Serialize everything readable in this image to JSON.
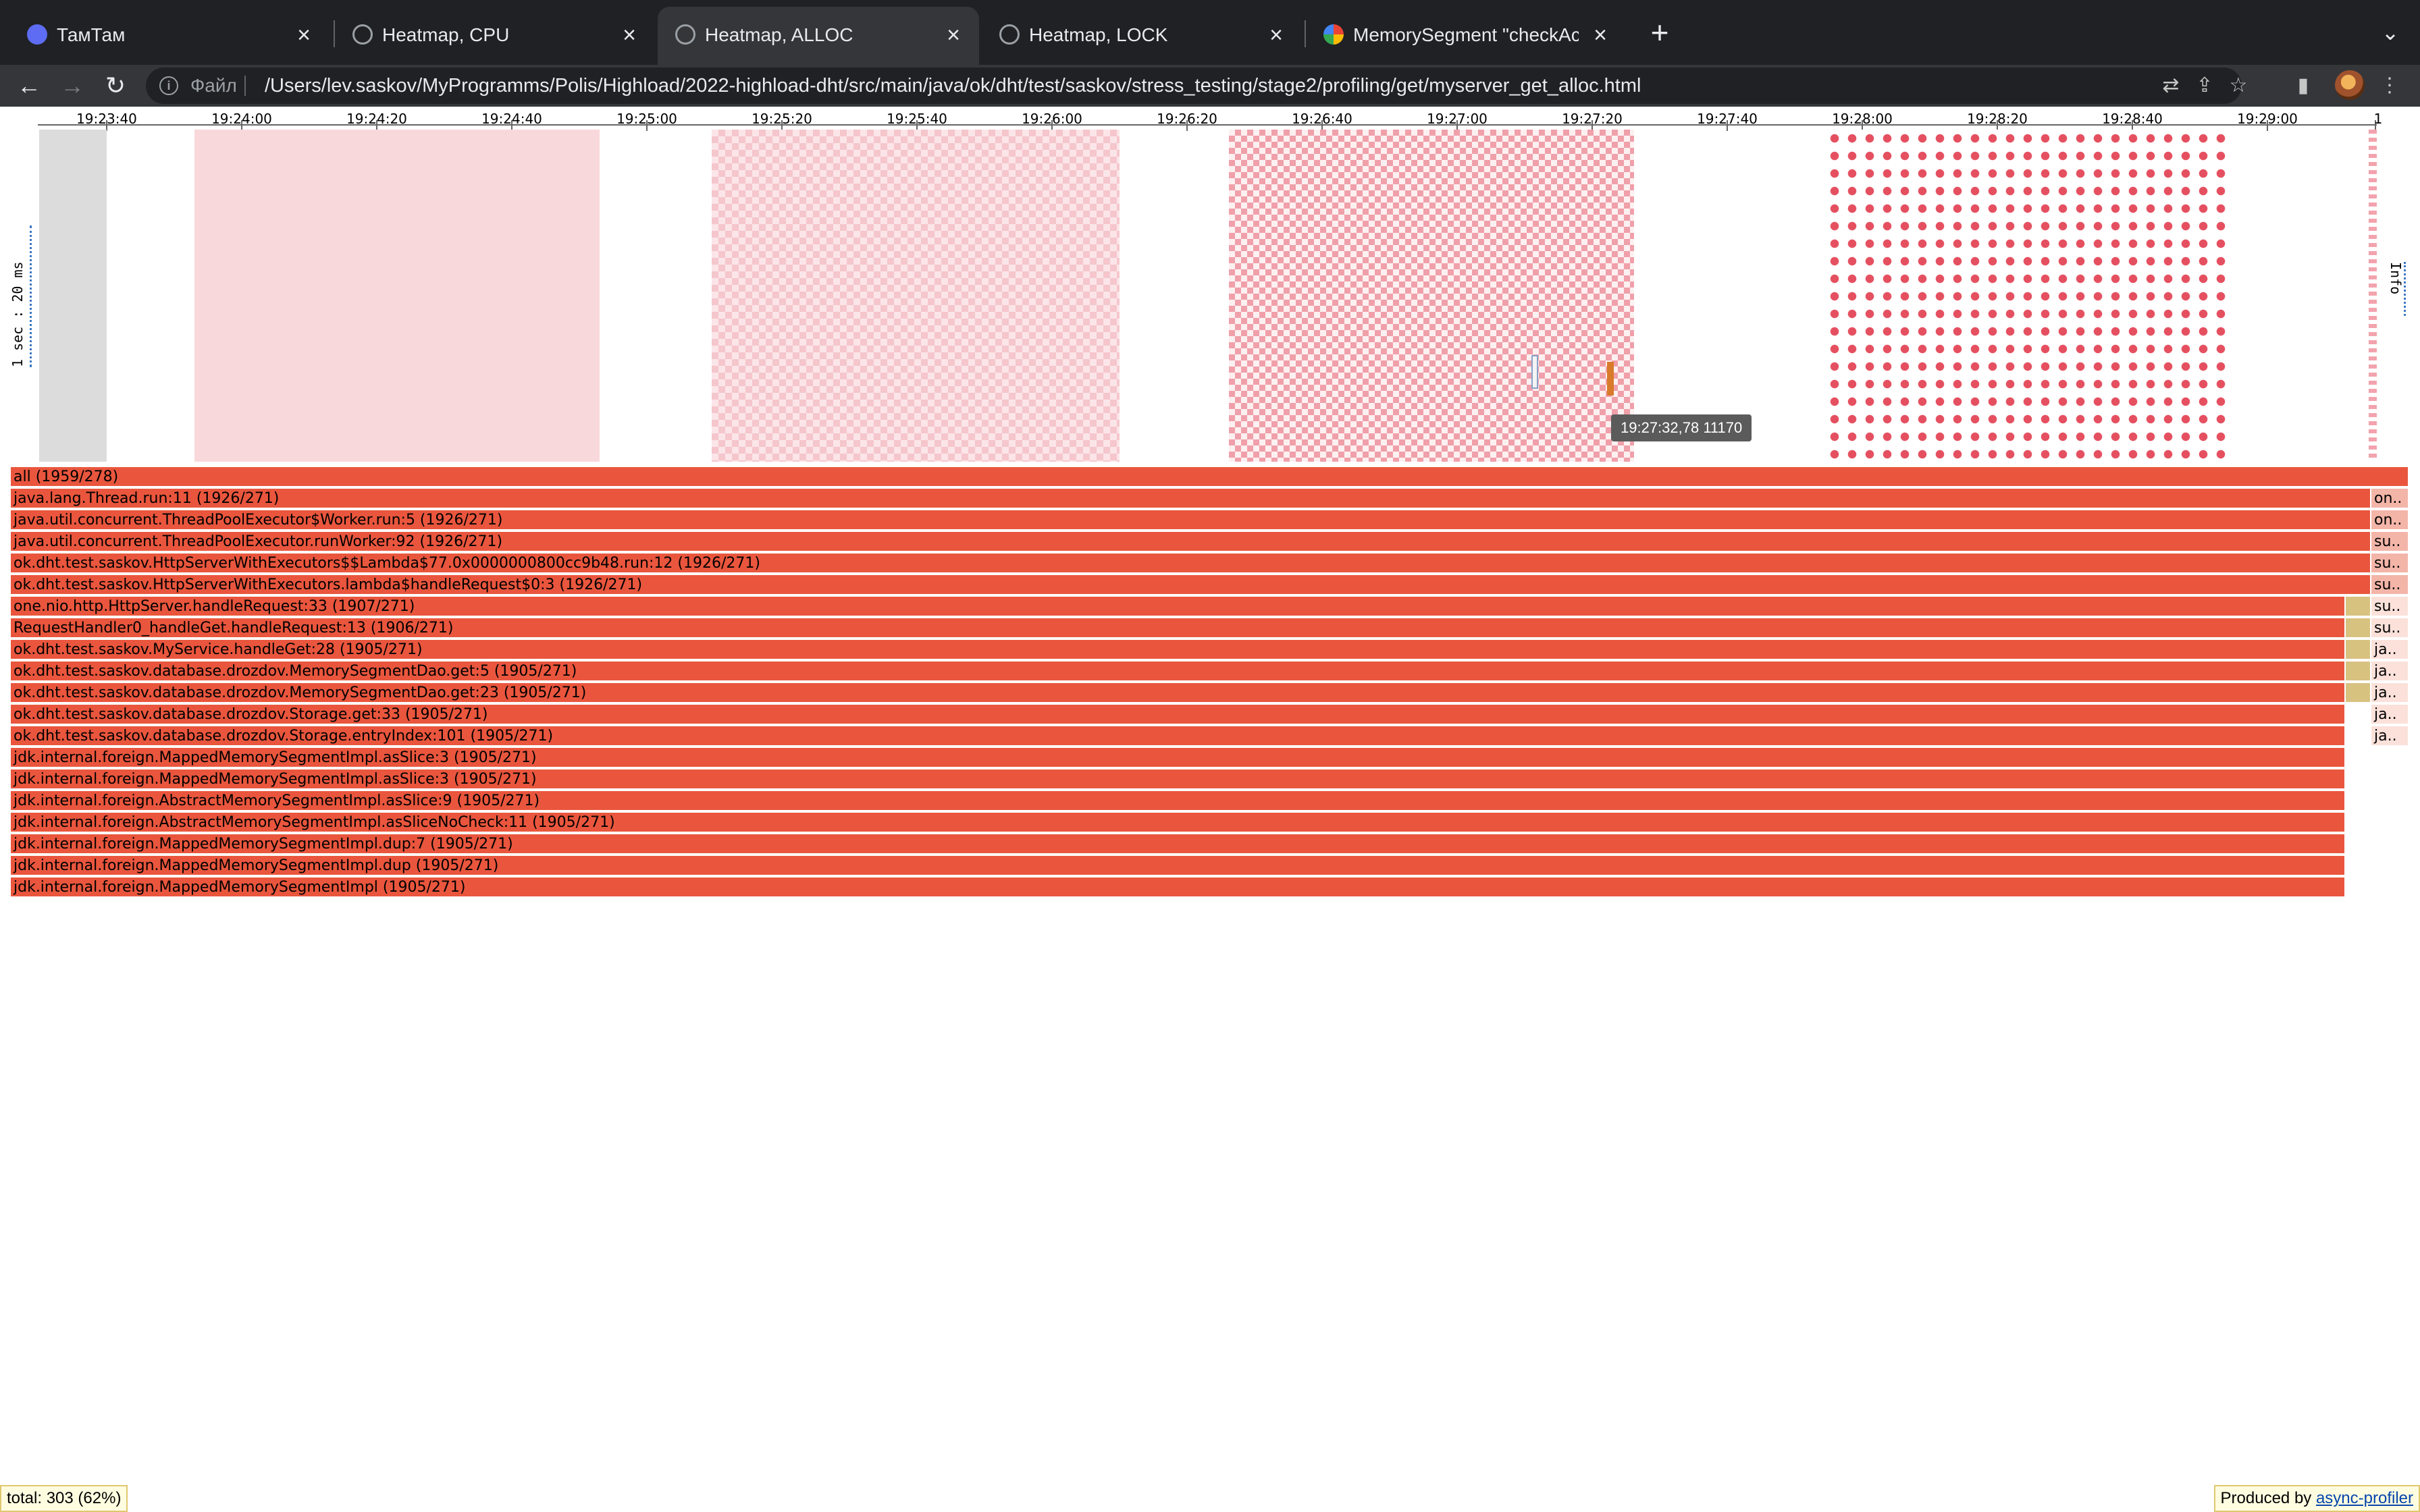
{
  "browser": {
    "tabs": [
      {
        "title": "ТамТам",
        "icon": "tamtam-icon",
        "active": false
      },
      {
        "title": "Heatmap, CPU",
        "icon": "globe-icon",
        "active": false
      },
      {
        "title": "Heatmap, ALLOC",
        "icon": "globe-icon",
        "active": true
      },
      {
        "title": "Heatmap, LOCK",
        "icon": "globe-icon",
        "active": false
      },
      {
        "title": "MemorySegment \"checkAcces",
        "icon": "google-icon",
        "active": false
      }
    ],
    "close_glyph": "×",
    "new_tab_glyph": "+",
    "tab_search_glyph": "⌄",
    "back_glyph": "←",
    "forward_glyph": "→",
    "reload_glyph": "↻",
    "scheme_label": "Файл",
    "url": "/Users/lev.saskov/MyProgramms/Polis/Highload/2022-highload-dht/src/main/java/ok/dht/test/saskov/stress_testing/stage2/profiling/get/myserver_get_alloc.html",
    "toolbar_icons": {
      "translate": "⇄",
      "share": "⇪",
      "bookmark": "☆",
      "sidebar": "▮",
      "menu": "⋮"
    }
  },
  "heatmap": {
    "time_ticks": [
      "19:23:40",
      "19:24:00",
      "19:24:20",
      "19:24:40",
      "19:25:00",
      "19:25:20",
      "19:25:40",
      "19:26:00",
      "19:26:20",
      "19:26:40",
      "19:27:00",
      "19:27:20",
      "19:27:40",
      "19:28:00",
      "19:28:20",
      "19:28:40",
      "19:29:00",
      "1"
    ],
    "scale_label": "1 sec : 20 ms",
    "info_label": "Info",
    "tooltip": "19:27:32,78 11170",
    "colors": {
      "heat_light": "#f9d8dc",
      "heat_dark": "#e55060",
      "selection": "#d87b2a"
    }
  },
  "flamegraph": {
    "frames": [
      {
        "label": "all (1959/278)"
      },
      {
        "label": "java.lang.Thread.run:11 (1926/271)",
        "side": "on.."
      },
      {
        "label": "java.util.concurrent.ThreadPoolExecutor$Worker.run:5 (1926/271)",
        "side": "on.."
      },
      {
        "label": "java.util.concurrent.ThreadPoolExecutor.runWorker:92 (1926/271)",
        "side": "su.."
      },
      {
        "label": "ok.dht.test.saskov.HttpServerWithExecutors$$Lambda$77.0x0000000800cc9b48.run:12 (1926/271)",
        "side": "su.."
      },
      {
        "label": "ok.dht.test.saskov.HttpServerWithExecutors.lambda$handleRequest$0:3 (1926/271)",
        "side": "su.."
      },
      {
        "label": "one.nio.http.HttpServer.handleRequest:33 (1907/271)",
        "side": "su.."
      },
      {
        "label": "RequestHandler0_handleGet.handleRequest:13 (1906/271)",
        "side": "su.."
      },
      {
        "label": "ok.dht.test.saskov.MyService.handleGet:28 (1905/271)",
        "side": "ja.."
      },
      {
        "label": "ok.dht.test.saskov.database.drozdov.MemorySegmentDao.get:5 (1905/271)",
        "side": "ja.."
      },
      {
        "label": "ok.dht.test.saskov.database.drozdov.MemorySegmentDao.get:23 (1905/271)",
        "side": "ja.."
      },
      {
        "label": "ok.dht.test.saskov.database.drozdov.Storage.get:33 (1905/271)",
        "side": "ja.."
      },
      {
        "label": "ok.dht.test.saskov.database.drozdov.Storage.entryIndex:101 (1905/271)",
        "side": "ja.."
      },
      {
        "label": "jdk.internal.foreign.MappedMemorySegmentImpl.asSlice:3 (1905/271)"
      },
      {
        "label": "jdk.internal.foreign.MappedMemorySegmentImpl.asSlice:3 (1905/271)"
      },
      {
        "label": "jdk.internal.foreign.AbstractMemorySegmentImpl.asSlice:9 (1905/271)"
      },
      {
        "label": "jdk.internal.foreign.AbstractMemorySegmentImpl.asSliceNoCheck:11 (1905/271)"
      },
      {
        "label": "jdk.internal.foreign.MappedMemorySegmentImpl.dup:7 (1905/271)"
      },
      {
        "label": "jdk.internal.foreign.MappedMemorySegmentImpl.dup (1905/271)"
      },
      {
        "label": "jdk.internal.foreign.MappedMemorySegmentImpl (1905/271)"
      }
    ],
    "colors": {
      "frame": "#e9563d",
      "side_frame": "#f3b5a8",
      "yellow_frame": "#d8c280"
    }
  },
  "status": {
    "total": "total: 303 (62%)",
    "produced_by": "Produced by ",
    "profiler_link": "async-profiler"
  }
}
